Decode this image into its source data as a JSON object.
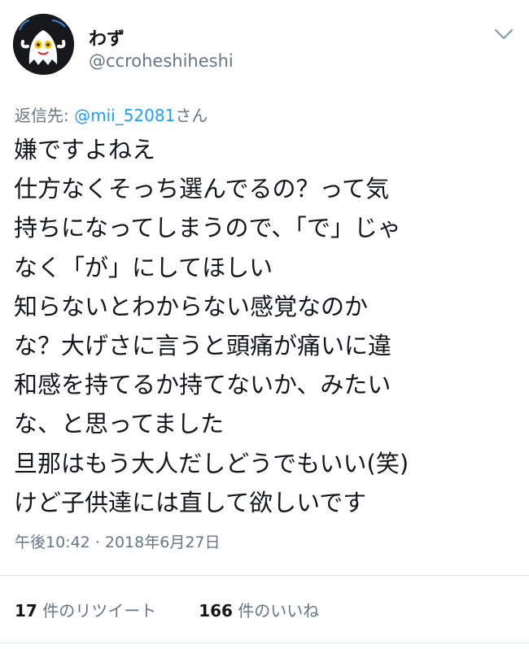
{
  "author": {
    "display_name": "わず",
    "handle": "@ccroheshiheshi",
    "avatar_icon": "ghost-avatar-icon"
  },
  "menu_icon": "chevron-down-icon",
  "reply": {
    "prefix": "返信先: ",
    "mention": "@mii_52081",
    "suffix": "さん"
  },
  "tweet": {
    "lines": [
      "嫌ですよねえ",
      "仕方なくそっち選んでるの？って気",
      "持ちになってしまうので、「で」じゃ",
      "なく「が」にしてほしい",
      "知らないとわからない感覚なのか",
      "な？大げさに言うと頭痛が痛いに違",
      "和感を持てるか持てないか、みたい",
      "な、と思ってました",
      "旦那はもう大人だしどうでもいい(笑)",
      "けど子供達には直して欲しいです"
    ]
  },
  "timestamp": "午後10:42 · 2018年6月27日",
  "stats": {
    "retweets": {
      "count": "17",
      "label": " 件のリツイート"
    },
    "likes": {
      "count": "166",
      "label": " 件のいいね"
    }
  },
  "colors": {
    "text": "#14171a",
    "secondary": "#657786",
    "link": "#1da1f2",
    "divider": "#e1e8ed"
  }
}
